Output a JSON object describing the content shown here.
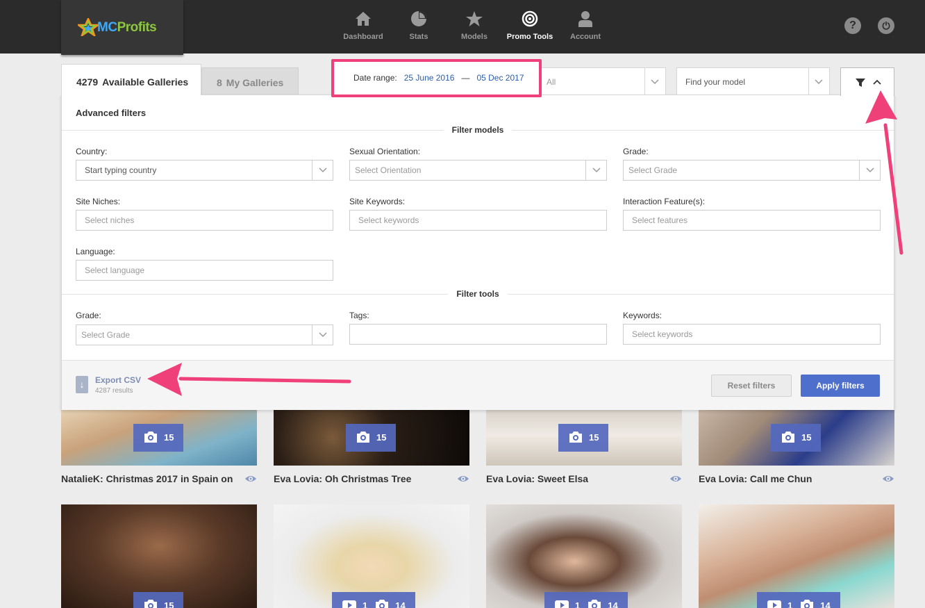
{
  "app": {
    "logo_text_mc": "MC",
    "logo_text_rest": "Profits"
  },
  "nav": [
    {
      "label": "Dashboard",
      "icon": "home-icon",
      "active": false
    },
    {
      "label": "Stats",
      "icon": "pie-chart-icon",
      "active": false
    },
    {
      "label": "Models",
      "icon": "star-icon",
      "active": false
    },
    {
      "label": "Promo Tools",
      "icon": "target-icon",
      "active": true
    },
    {
      "label": "Account",
      "icon": "user-icon",
      "active": false
    }
  ],
  "top_actions": {
    "help": "?",
    "power": "⏻"
  },
  "tabs": {
    "available": {
      "count": "4279",
      "label": "Available Galleries"
    },
    "mine": {
      "count": "8",
      "label": "My Galleries"
    }
  },
  "date_range": {
    "label": "Date range:",
    "from": "25 June 2016",
    "separator": "—",
    "to": "05 Dec 2017"
  },
  "type_select": {
    "value": "All"
  },
  "model_search": {
    "placeholder": "Find your model"
  },
  "advanced": {
    "title": "Advanced filters",
    "models_section": "Filter models",
    "tools_section": "Filter tools",
    "country": {
      "label": "Country:",
      "placeholder": "Start typing country"
    },
    "orientation": {
      "label": "Sexual Orientation:",
      "placeholder": "Select Orientation"
    },
    "grade": {
      "label": "Grade:",
      "placeholder": "Select Grade"
    },
    "niches": {
      "label": "Site Niches:",
      "placeholder": "Select niches"
    },
    "site_keywords": {
      "label": "Site Keywords:",
      "placeholder": "Select keywords"
    },
    "interaction": {
      "label": "Interaction Feature(s):",
      "placeholder": "Select features"
    },
    "language": {
      "label": "Language:",
      "placeholder": "Select language"
    },
    "tool_grade": {
      "label": "Grade:",
      "placeholder": "Select Grade"
    },
    "tags": {
      "label": "Tags:",
      "placeholder": ""
    },
    "keywords": {
      "label": "Keywords:",
      "placeholder": "Select keywords"
    },
    "export_label": "Export CSV",
    "export_count": "4287 results",
    "reset": "Reset filters",
    "apply": "Apply filters"
  },
  "galleries_row1": [
    {
      "title": "NatalieK: Christmas 2017 in Spain on",
      "photos": "15"
    },
    {
      "title": "Eva Lovia: Oh Christmas Tree",
      "photos": "15"
    },
    {
      "title": "Eva Lovia: Sweet Elsa",
      "photos": "15"
    },
    {
      "title": "Eva Lovia: Call me Chun",
      "photos": "15"
    }
  ],
  "galleries_row2": [
    {
      "photos": "15"
    },
    {
      "videos": "1",
      "photos": "14"
    },
    {
      "videos": "1",
      "photos": "14"
    },
    {
      "videos": "1",
      "photos": "14"
    }
  ],
  "colors": {
    "accent": "#4f6fcd",
    "highlight": "#f0407a",
    "nav_bg": "#2b2b2b"
  }
}
